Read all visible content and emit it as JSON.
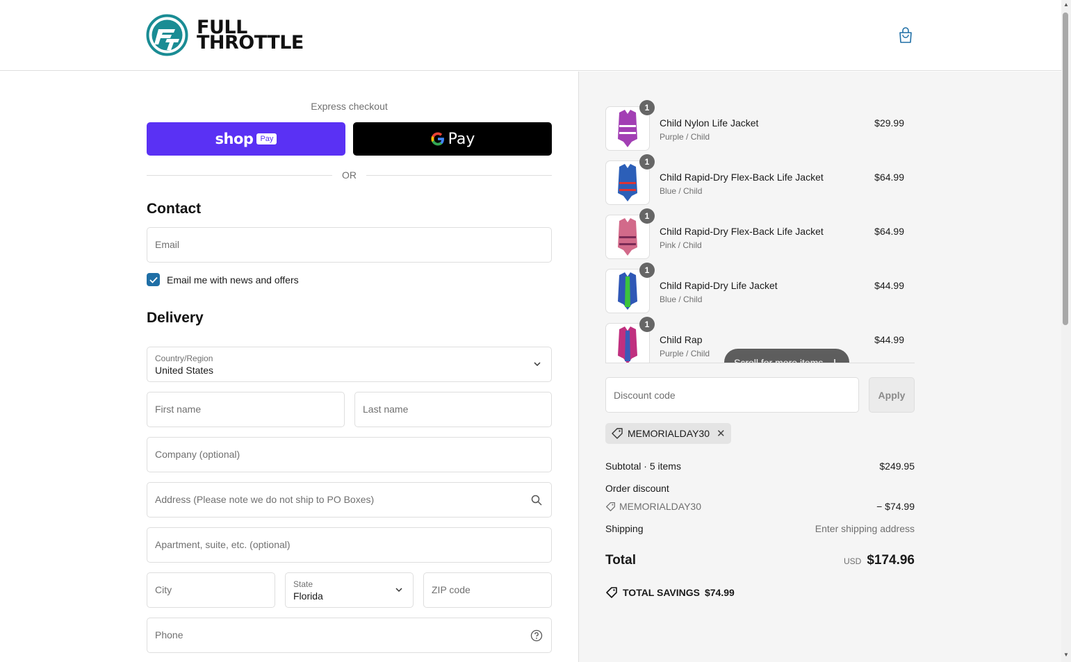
{
  "brand": {
    "name_line1": "FULL",
    "name_line2": "THROTTLE",
    "logo_letters": "FT"
  },
  "colors": {
    "shop_pay": "#5a31f4",
    "accent": "#1f6fa6",
    "logo_teal": "#1a8c94"
  },
  "express": {
    "label": "Express checkout",
    "shop_word": "shop",
    "shop_pay_tag": "Pay",
    "gpay_label": "Pay",
    "or_label": "OR"
  },
  "contact": {
    "title": "Contact",
    "email_placeholder": "Email",
    "newsletter_label": "Email me with news and offers",
    "newsletter_checked": true
  },
  "delivery": {
    "title": "Delivery",
    "country_label": "Country/Region",
    "country_value": "United States",
    "first_name_placeholder": "First name",
    "last_name_placeholder": "Last name",
    "company_placeholder": "Company (optional)",
    "address_placeholder": "Address (Please note we do not ship to PO Boxes)",
    "apartment_placeholder": "Apartment, suite, etc. (optional)",
    "city_placeholder": "City",
    "state_label": "State",
    "state_value": "Florida",
    "zip_placeholder": "ZIP code",
    "phone_placeholder": "Phone"
  },
  "cart": {
    "items": [
      {
        "qty": "1",
        "name": "Child Nylon Life Jacket",
        "variant": "Purple / Child",
        "price": "$29.99",
        "color": "#a23fb4"
      },
      {
        "qty": "1",
        "name": "Child Rapid-Dry Flex-Back Life Jacket",
        "variant": "Blue / Child",
        "price": "$64.99",
        "color": "#2c5fb8"
      },
      {
        "qty": "1",
        "name": "Child Rapid-Dry Flex-Back Life Jacket",
        "variant": "Pink / Child",
        "price": "$64.99",
        "color": "#d26a8a"
      },
      {
        "qty": "1",
        "name": "Child Rapid-Dry Life Jacket",
        "variant": "Blue / Child",
        "price": "$44.99",
        "color": "#2f58b6"
      },
      {
        "qty": "1",
        "name": "Child Rapid-Dry Life Jacket",
        "variant": "Purple / Child",
        "price": "$44.99",
        "color": "#c0307f"
      }
    ],
    "item5_visible_name": "Child Rap",
    "scroll_more_label": "Scroll for more items",
    "discount_placeholder": "Discount code",
    "apply_label": "Apply",
    "applied_code": "MEMORIALDAY30",
    "subtotal_label": "Subtotal · 5 items",
    "subtotal_value": "$249.95",
    "order_discount_label": "Order discount",
    "discount_code": "MEMORIALDAY30",
    "discount_value": "− $74.99",
    "shipping_label": "Shipping",
    "shipping_value": "Enter shipping address",
    "total_label": "Total",
    "total_currency": "USD",
    "total_value": "$174.96",
    "savings_label": "TOTAL SAVINGS",
    "savings_value": "$74.99"
  }
}
